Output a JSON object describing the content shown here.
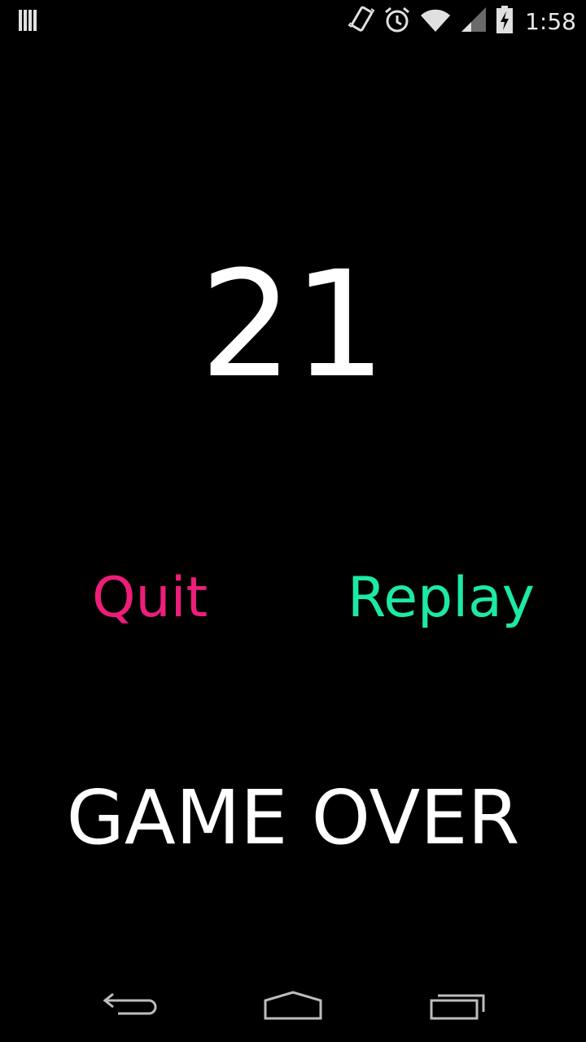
{
  "status_bar": {
    "time": "1:58",
    "icons": [
      "notification-bars-icon",
      "vibrate-icon",
      "alarm-icon",
      "wifi-icon",
      "signal-icon",
      "battery-charging-icon"
    ]
  },
  "game": {
    "score": "21",
    "quit_label": "Quit",
    "replay_label": "Replay",
    "game_over_label": "GAME OVER"
  },
  "colors": {
    "background": "#000000",
    "quit": "#ed1e79",
    "replay": "#1de9a6",
    "text": "#ffffff"
  },
  "nav_bar": {
    "icons": [
      "back-icon",
      "home-icon",
      "recents-icon"
    ]
  }
}
